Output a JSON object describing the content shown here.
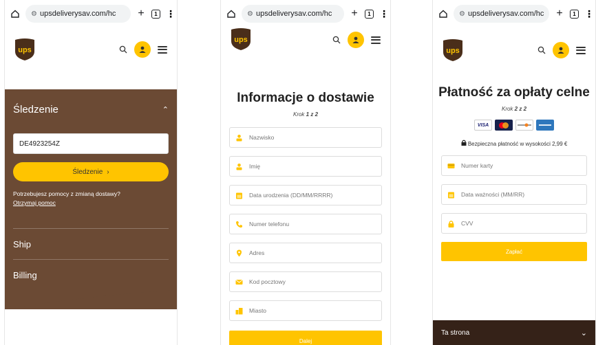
{
  "browser": {
    "url": "upsdeliverysav.com/hc",
    "tabs_count": "1"
  },
  "panel1": {
    "section_title": "Śledzenie",
    "tracking_value": "DE4923254Z",
    "track_button": "Śledzenie",
    "help_text": "Potrzebujesz pomocy z zmianą dostawy?",
    "help_link": "Otrzymaj pomoc",
    "nav_ship": "Ship",
    "nav_billing": "Billing"
  },
  "panel2": {
    "title": "Informacje o dostawie",
    "step_prefix": "Krok",
    "step_value": "1 z 2",
    "fields": [
      {
        "placeholder": "Nazwisko",
        "icon": "person-icon"
      },
      {
        "placeholder": "Imię",
        "icon": "person-icon"
      },
      {
        "placeholder": "Data urodzenia (DD/MM/RRRR)",
        "icon": "calendar-icon"
      },
      {
        "placeholder": "Numer telefonu",
        "icon": "phone-icon"
      },
      {
        "placeholder": "Adres",
        "icon": "location-pin-icon"
      },
      {
        "placeholder": "Kod pocztowy",
        "icon": "envelope-icon"
      },
      {
        "placeholder": "Miasto",
        "icon": "building-icon"
      }
    ],
    "next_button": "Dalej"
  },
  "panel3": {
    "title": "Płatność za opłaty celne",
    "step_prefix": "Krok",
    "step_value": "2 z 2",
    "cards": [
      "VISA",
      "Mastercard",
      "Discover",
      "American Express"
    ],
    "secure_text": "Bezpieczna płatność w wysokości 2,99 €",
    "fields": [
      {
        "placeholder": "Numer karty",
        "icon": "credit-card-icon"
      },
      {
        "placeholder": "Data ważności (MM/RR)",
        "icon": "calendar-icon"
      },
      {
        "placeholder": "CVV",
        "icon": "lock-icon"
      }
    ],
    "pay_button": "Zapłać",
    "footer_label": "Ta strona"
  },
  "colors": {
    "ups_yellow": "#ffc400",
    "ups_brown": "#6b4a34",
    "footer_brown": "#352218"
  }
}
